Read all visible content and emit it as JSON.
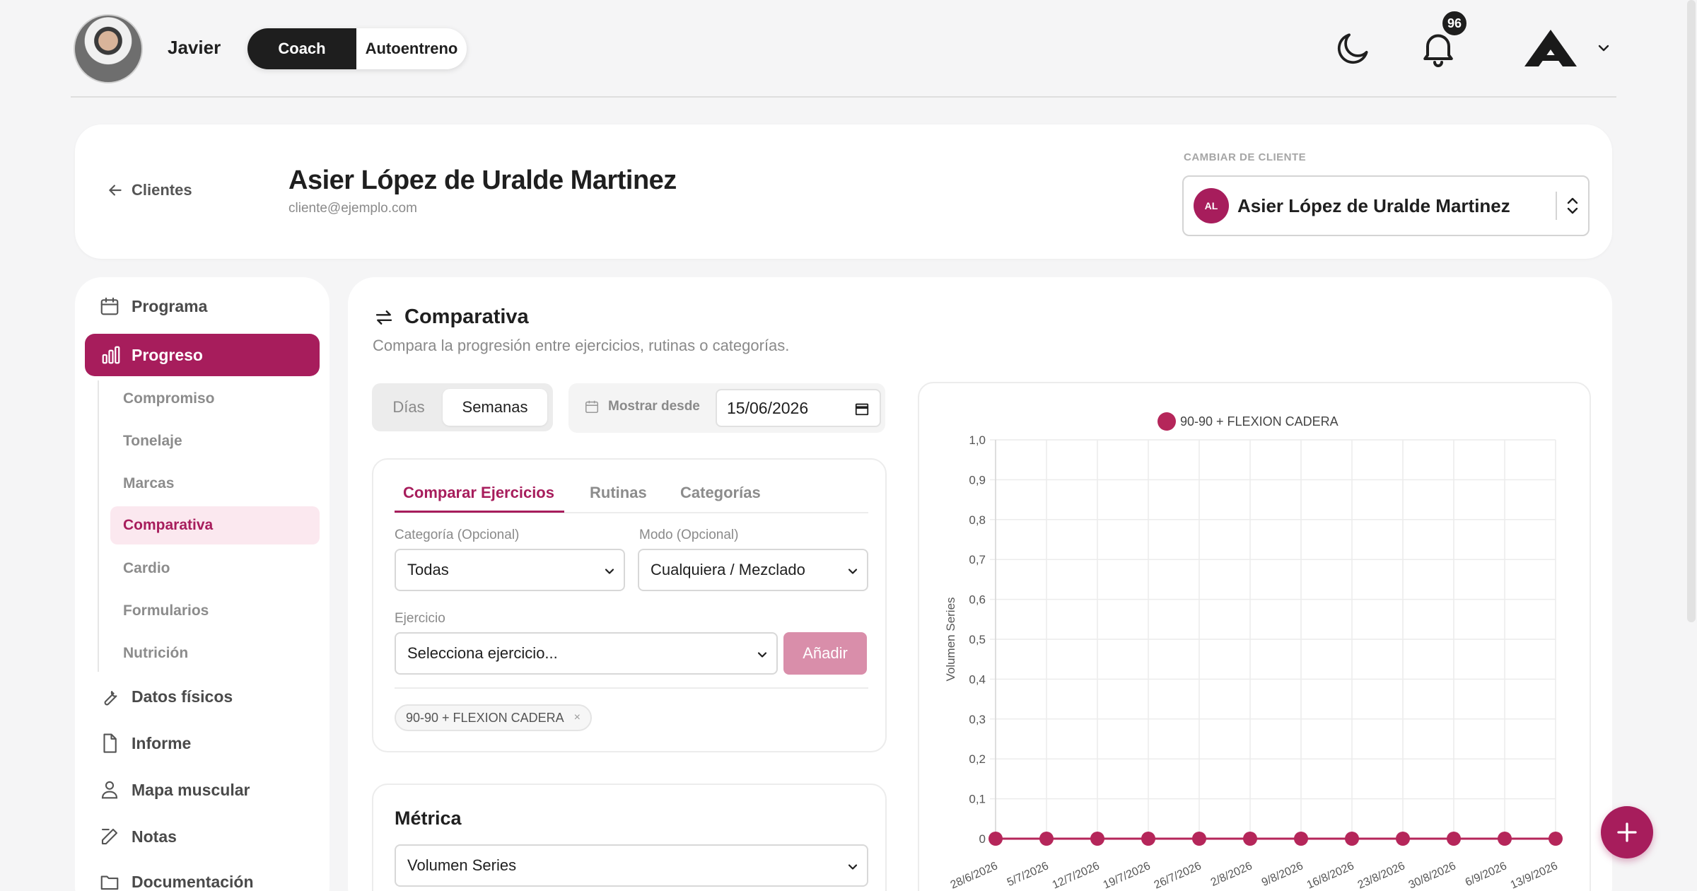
{
  "colors": {
    "accent": "#a71d5c",
    "accent_light": "#fbe8ef",
    "dark": "#1e1e1e"
  },
  "header": {
    "user_name": "Javier",
    "mode_active": "Coach",
    "mode_other": "Autoentreno",
    "notification_count": "96",
    "icons": [
      "moon-icon",
      "bell-icon",
      "brand-logo",
      "chevron-down-icon"
    ]
  },
  "client": {
    "back_label": "Clientes",
    "name": "Asier López de Uralde Martinez",
    "email": "cliente@ejemplo.com",
    "switch_label": "CAMBIAR DE CLIENTE",
    "initials": "AL",
    "selected_client": "Asier López de Uralde Martinez"
  },
  "sidebar": {
    "programa": "Programa",
    "progreso": "Progreso",
    "sub": [
      "Compromiso",
      "Tonelaje",
      "Marcas",
      "Comparativa",
      "Cardio",
      "Formularios",
      "Nutrición"
    ],
    "datos": "Datos físicos",
    "informe": "Informe",
    "mapa": "Mapa muscular",
    "notas": "Notas",
    "documentacion": "Documentación"
  },
  "main": {
    "title": "Comparativa",
    "subtitle": "Compara la progresión entre ejercicios, rutinas o categorías.",
    "period": {
      "days": "Días",
      "weeks": "Semanas",
      "selected": "Semanas"
    },
    "since_label": "Mostrar desde",
    "since_date": "15/06/2026",
    "tabs": [
      "Comparar Ejercicios",
      "Rutinas",
      "Categorías"
    ],
    "category_label": "Categoría (Opcional)",
    "category_value": "Todas",
    "mode_label": "Modo (Opcional)",
    "mode_value": "Cualquiera / Mezclado",
    "exercise_label": "Ejercicio",
    "exercise_placeholder": "Selecciona ejercicio...",
    "add_label": "Añadir",
    "chip_label": "90-90 + FLEXION CADERA",
    "chip_remove": "×",
    "metric_title": "Métrica",
    "metric_value": "Volumen Series"
  },
  "chart_data": {
    "type": "line",
    "ylabel": "Volumen Series",
    "ylim": [
      0,
      1
    ],
    "yticks": [
      "0",
      "0,1",
      "0,2",
      "0,3",
      "0,4",
      "0,5",
      "0,6",
      "0,7",
      "0,8",
      "0,9",
      "1,0"
    ],
    "categories": [
      "28/6/2026",
      "5/7/2026",
      "12/7/2026",
      "19/7/2026",
      "26/7/2026",
      "2/8/2026",
      "9/8/2026",
      "16/8/2026",
      "23/8/2026",
      "30/8/2026",
      "6/9/2026",
      "13/9/2026"
    ],
    "series": [
      {
        "name": "90-90 + FLEXION CADERA",
        "color": "#b5265a",
        "values": [
          0,
          0,
          0,
          0,
          0,
          0,
          0,
          0,
          0,
          0,
          0,
          0
        ]
      }
    ],
    "legend": "top",
    "grid": true
  }
}
